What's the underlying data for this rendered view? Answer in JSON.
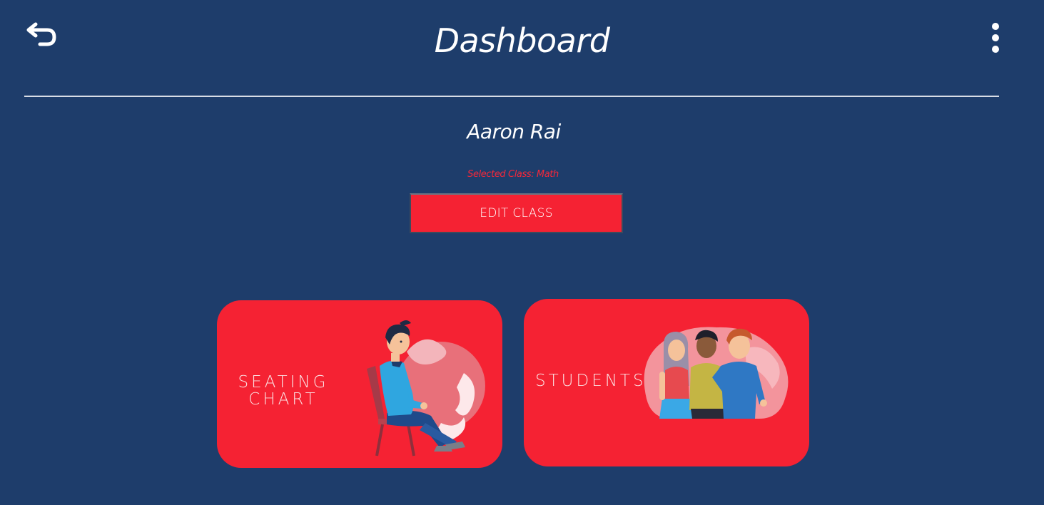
{
  "header": {
    "title": "Dashboard",
    "back_icon": "back-arrow-icon",
    "menu_icon": "more-vertical-icon"
  },
  "profile": {
    "name": "Aaron Rai",
    "selected_class": "Selected Class: Math",
    "edit_button_label": "EDIT CLASS"
  },
  "cards": [
    {
      "label_line1": "SEATING",
      "label_line2": "CHART",
      "illustration": "person-sitting-on-chair-illustration"
    },
    {
      "label": "STUDENTS",
      "illustration": "group-of-students-illustration"
    }
  ],
  "colors": {
    "background": "#1e3d6b",
    "accent": "#f52233",
    "selected_class_text": "#f5283a",
    "text": "#ffffff"
  }
}
